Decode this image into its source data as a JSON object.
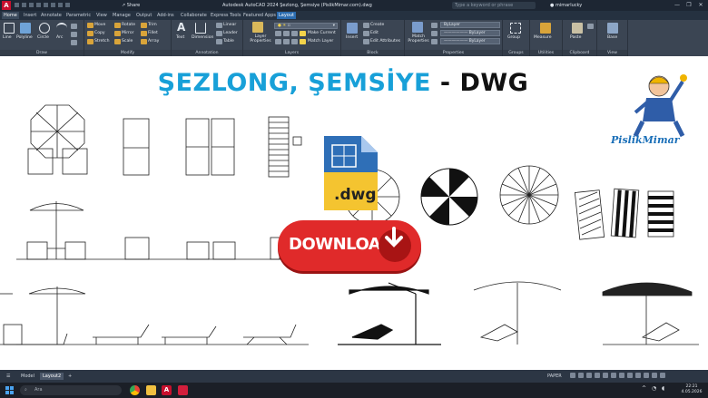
{
  "window": {
    "app_icon": "A",
    "share_label": "Share",
    "title": "Autodesk AutoCAD 2024  Şezlong, Şemsiye (PislikMimar.com).dwg",
    "search_placeholder": "Type a keyword or phrase",
    "user": "mimarlucky",
    "controls": [
      "—",
      "❐",
      "✕"
    ]
  },
  "ribbon_tabs": [
    "Home",
    "Insert",
    "Annotate",
    "Parametric",
    "View",
    "Manage",
    "Output",
    "Add-ins",
    "Collaborate",
    "Express Tools",
    "Featured Apps",
    "Layout"
  ],
  "ribbon": {
    "draw": {
      "label": "Draw",
      "tools": [
        "Line",
        "Polyline",
        "Circle",
        "Arc"
      ]
    },
    "modify": {
      "label": "Modify",
      "tools": [
        "Move",
        "Rotate",
        "Trim",
        "Copy",
        "Mirror",
        "Fillet",
        "Stretch",
        "Scale",
        "Array"
      ]
    },
    "annotation": {
      "label": "Annotation",
      "tools": [
        "Text",
        "Dimension",
        "Linear",
        "Leader",
        "Table"
      ]
    },
    "layers": {
      "label": "Layers",
      "tools": [
        "Layer Properties",
        "Make Current",
        "Match Layer"
      ]
    },
    "block": {
      "label": "Block",
      "tools": [
        "Insert",
        "Create",
        "Edit",
        "Edit Attributes"
      ]
    },
    "properties": {
      "label": "Properties",
      "tools": [
        "Match Properties"
      ],
      "dropdowns": [
        "ByLayer",
        "ByLayer",
        "ByLayer"
      ]
    },
    "groups": {
      "label": "Groups",
      "tools": [
        "Group"
      ]
    },
    "utilities": {
      "label": "Utilities",
      "tools": [
        "Measure"
      ]
    },
    "clipboard": {
      "label": "Clipboard",
      "tools": [
        "Paste"
      ]
    },
    "view": {
      "label": "View",
      "tools": [
        "Base"
      ]
    }
  },
  "canvas": {
    "heading_part1": "ŞEZLONG, ŞEMSİYE",
    "heading_part2": " - DWG",
    "file_badge": ".dwg",
    "download_label": "DOWNLOAD",
    "brand": "PislikMimar"
  },
  "layout_tabs": [
    "Model",
    "Layout2"
  ],
  "add_tab_label": "+",
  "status": {
    "mode": "PAPER"
  },
  "taskbar": {
    "search_placeholder": "Ara",
    "time": "22:21",
    "date": "4.05.2026"
  },
  "colors": {
    "heading_blue": "#18a0d8",
    "download_red": "#e02a2a",
    "brand_blue": "#1a6fb8",
    "accent_blue": "#2b6cb0"
  }
}
